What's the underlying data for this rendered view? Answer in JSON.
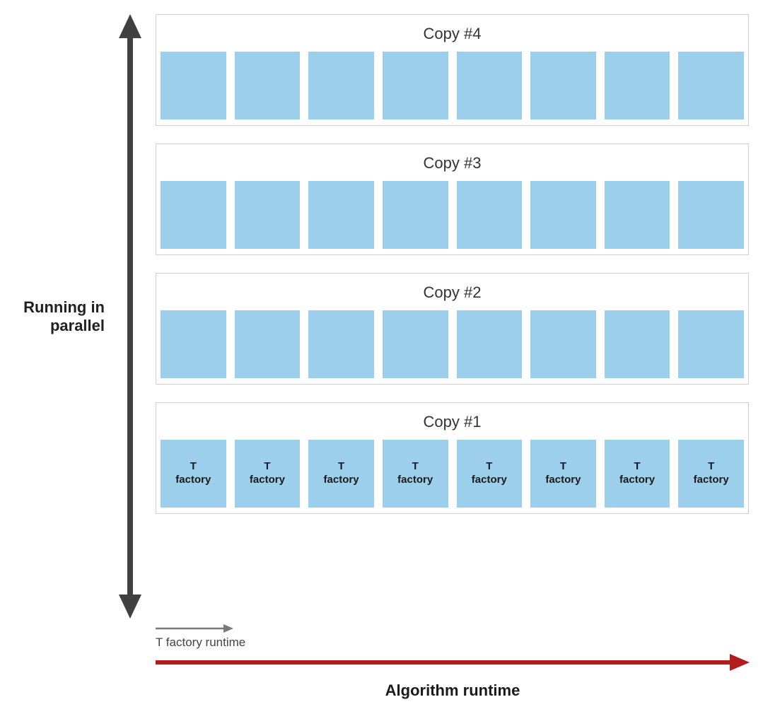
{
  "labels": {
    "vertical_axis": "Running in parallel",
    "horizontal_axis": "Algorithm runtime",
    "t_factory_runtime": "T factory runtime"
  },
  "copies": [
    {
      "title": "Copy #4"
    },
    {
      "title": "Copy #3"
    },
    {
      "title": "Copy #2"
    },
    {
      "title": "Copy #1"
    }
  ],
  "boxes_per_row": 8,
  "box_label": {
    "line1": "T",
    "line2": "factory"
  },
  "colors": {
    "box_fill": "#9ccfec",
    "panel_border": "#cfcfcf",
    "vertical_arrow": "#404040",
    "small_arrow": "#797979",
    "horizontal_arrow": "#b31c1c"
  }
}
